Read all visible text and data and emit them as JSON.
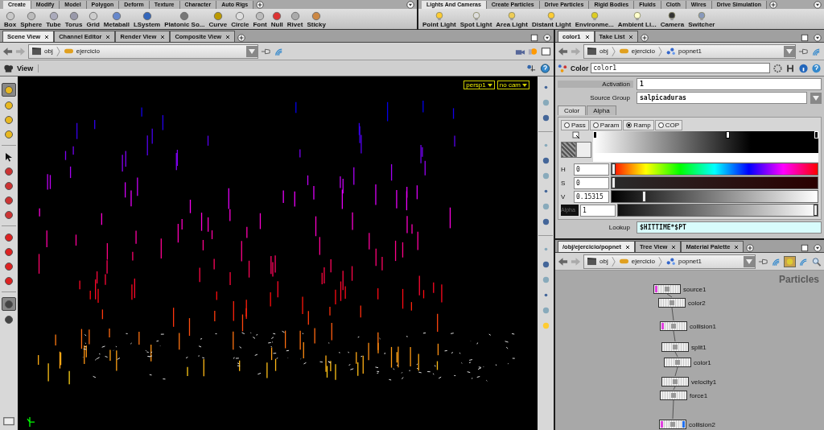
{
  "shelves": [
    {
      "tabs": [
        {
          "label": "Create",
          "selected": true
        },
        {
          "label": "Modify",
          "selected": false
        },
        {
          "label": "Model",
          "selected": false
        },
        {
          "label": "Polygon",
          "selected": false
        },
        {
          "label": "Deform",
          "selected": false
        },
        {
          "label": "Texture",
          "selected": false
        },
        {
          "label": "Character",
          "selected": false
        },
        {
          "label": "Auto Rigs",
          "selected": false
        }
      ],
      "tools": [
        "Box",
        "Sphere",
        "Tube",
        "Torus",
        "Grid",
        "Metaball",
        "LSystem",
        "Platonic So...",
        "Curve",
        "Circle",
        "Font",
        "Null",
        "Rivet",
        "Sticky"
      ]
    },
    {
      "tabs": [
        {
          "label": "Lights And Cameras",
          "selected": true
        },
        {
          "label": "Create Particles",
          "selected": false
        },
        {
          "label": "Drive Particles",
          "selected": false
        },
        {
          "label": "Rigid Bodies",
          "selected": false
        },
        {
          "label": "Fluids",
          "selected": false
        },
        {
          "label": "Cloth",
          "selected": false
        },
        {
          "label": "Wires",
          "selected": false
        },
        {
          "label": "Drive Simulation",
          "selected": false
        }
      ],
      "tools": [
        "Point Light",
        "Spot Light",
        "Area Light",
        "Distant Light",
        "Environme...",
        "Ambient Li...",
        "Camera",
        "Switcher"
      ]
    }
  ],
  "scene_view": {
    "tabs": [
      {
        "label": "Scene View",
        "selected": true
      },
      {
        "label": "Channel Editor",
        "selected": false
      },
      {
        "label": "Render View",
        "selected": false
      },
      {
        "label": "Composite View",
        "selected": false
      }
    ],
    "path": [
      "obj",
      "ejercicio"
    ],
    "title": "View",
    "camera": "persp1",
    "view_camera": "no cam",
    "left_tools": [
      {
        "selected": true
      },
      {
        "selected": false
      },
      {
        "selected": false
      },
      {
        "selected": false
      },
      {
        "selected": false
      },
      {
        "selected": false
      },
      {
        "selected": false
      },
      {
        "selected": false
      },
      {
        "selected": false
      },
      {
        "selected": false
      },
      {
        "selected": false
      },
      {
        "selected": false
      },
      {
        "selected": false
      },
      {
        "selected": true
      },
      {
        "selected": false
      }
    ]
  },
  "parameters": {
    "tabs": [
      {
        "label": "color1",
        "selected": true
      },
      {
        "label": "Take List",
        "selected": false
      }
    ],
    "path": [
      "obj",
      "ejercicio",
      "popnet1"
    ],
    "node_type": "Color",
    "node_name": "color1",
    "fields": [
      {
        "label": "Activation",
        "value": "1",
        "kind": "text"
      },
      {
        "label": "Source Group",
        "value": "salpicaduras",
        "kind": "menu"
      }
    ],
    "subtabs": [
      {
        "label": "Color",
        "selected": true
      },
      {
        "label": "Alpha",
        "selected": false
      }
    ],
    "modes": [
      {
        "label": "Pass",
        "selected": false
      },
      {
        "label": "Param",
        "selected": false
      },
      {
        "label": "Ramp",
        "selected": true
      },
      {
        "label": "COP",
        "selected": false
      }
    ],
    "ramp_keys": [
      {
        "level": 0,
        "selected": false
      },
      {
        "level": 0.6,
        "selected": true
      },
      {
        "level": 1,
        "selected": false
      }
    ],
    "channels": [
      {
        "label": "H",
        "value": "0",
        "level": 0,
        "kind": "hue"
      },
      {
        "label": "S",
        "value": "0",
        "level": 0,
        "kind": "saturation"
      },
      {
        "label": "V",
        "value": "0.15315",
        "level": 0.15,
        "kind": "value"
      }
    ],
    "alpha": {
      "label": "Alpha",
      "value": "1",
      "level": 1
    },
    "lookup": {
      "label": "Lookup",
      "value": "$HITTIME*$PT"
    }
  },
  "network": {
    "tabs": [
      {
        "label": "/obj/ejercicio/popnet",
        "selected": true
      },
      {
        "label": "Tree View",
        "selected": false
      },
      {
        "label": "Material Palette",
        "selected": false
      }
    ],
    "path": [
      "obj",
      "ejercicio",
      "popnet1"
    ],
    "context": "Particles",
    "nodes": [
      {
        "name": "source1",
        "template": true,
        "display": false
      },
      {
        "name": "color2",
        "template": false,
        "display": false
      },
      {
        "name": "collision1",
        "template": true,
        "display": false
      },
      {
        "name": "split1",
        "template": false,
        "display": false
      },
      {
        "name": "color1",
        "template": false,
        "display": false
      },
      {
        "name": "velocity1",
        "template": false,
        "display": false
      },
      {
        "name": "force1",
        "template": false,
        "display": false
      },
      {
        "name": "collision2",
        "template": true,
        "display": true
      }
    ]
  }
}
